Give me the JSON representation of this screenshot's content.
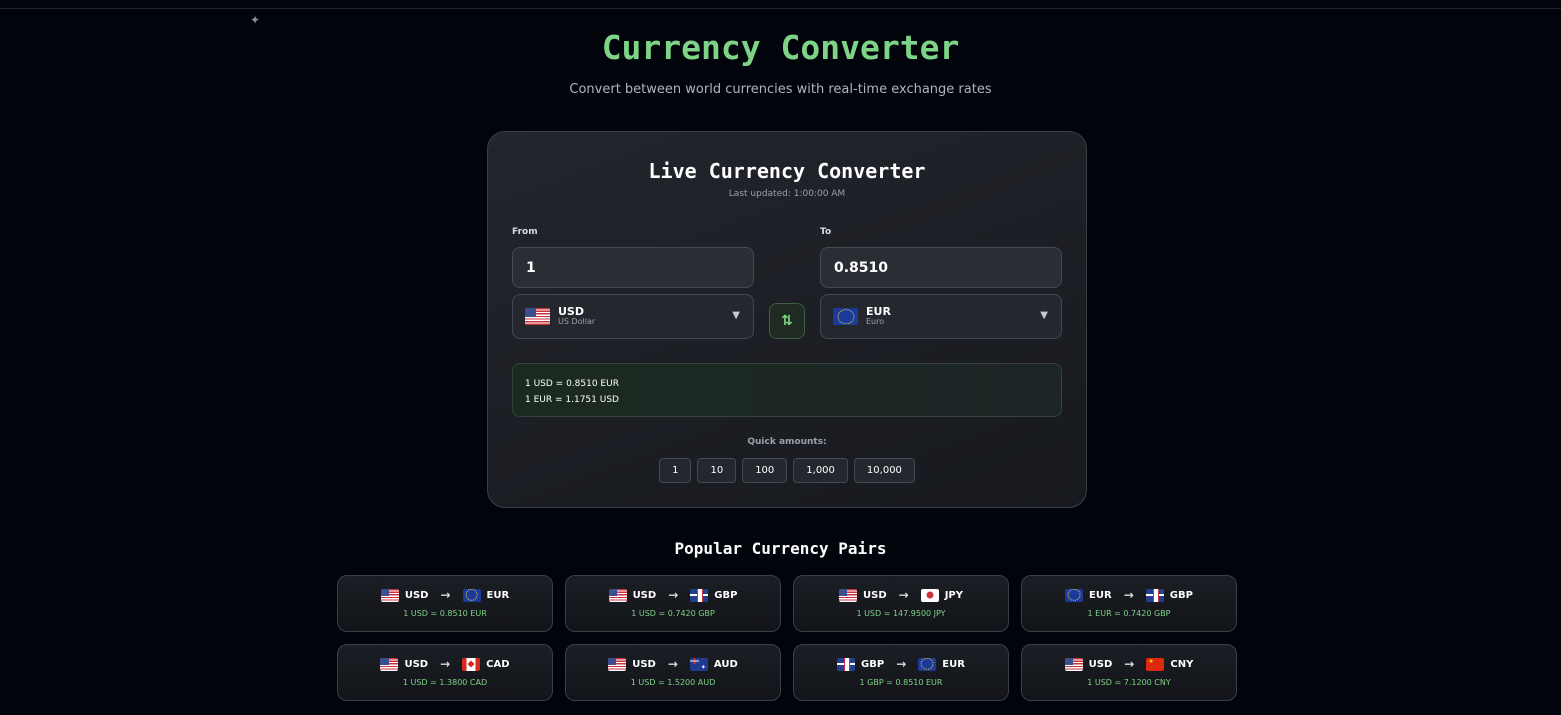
{
  "header": {
    "sparkle": "✦",
    "title": "Currency Converter",
    "subtitle": "Convert between world currencies with real-time exchange rates"
  },
  "converter": {
    "title": "Live Currency Converter",
    "last_updated": "Last updated: 1:00:00 AM",
    "from": {
      "label": "From",
      "amount": "1",
      "currency_code": "USD",
      "currency_name": "US Dollar",
      "flag": "us-flag-icon"
    },
    "to": {
      "label": "To",
      "amount": "0.8510",
      "currency_code": "EUR",
      "currency_name": "Euro",
      "flag": "eu-flag-icon"
    },
    "swap_icon": "⇅",
    "caret": "▼",
    "rates": {
      "forward": "1 USD = 0.8510 EUR",
      "reverse": "1 EUR = 1.1751 USD"
    },
    "quick_label": "Quick amounts:",
    "quick_amounts": [
      "1",
      "10",
      "100",
      "1,000",
      "10,000"
    ]
  },
  "popular": {
    "title": "Popular Currency Pairs",
    "arrow": "→",
    "pairs": [
      {
        "from": "USD",
        "to": "EUR",
        "from_flag": "us",
        "to_flag": "eu",
        "rate": "1 USD = 0.8510 EUR"
      },
      {
        "from": "USD",
        "to": "GBP",
        "from_flag": "us",
        "to_flag": "gb",
        "rate": "1 USD = 0.7420 GBP"
      },
      {
        "from": "USD",
        "to": "JPY",
        "from_flag": "us",
        "to_flag": "jp",
        "rate": "1 USD = 147.9500 JPY"
      },
      {
        "from": "EUR",
        "to": "GBP",
        "from_flag": "eu",
        "to_flag": "gb",
        "rate": "1 EUR = 0.7420 GBP"
      },
      {
        "from": "USD",
        "to": "CAD",
        "from_flag": "us",
        "to_flag": "ca",
        "rate": "1 USD = 1.3800 CAD"
      },
      {
        "from": "USD",
        "to": "AUD",
        "from_flag": "us",
        "to_flag": "au",
        "rate": "1 USD = 1.5200 AUD"
      },
      {
        "from": "GBP",
        "to": "EUR",
        "from_flag": "gb",
        "to_flag": "eu",
        "rate": "1 GBP = 0.8510 EUR"
      },
      {
        "from": "USD",
        "to": "CNY",
        "from_flag": "us",
        "to_flag": "cn",
        "rate": "1 USD = 7.1200 CNY"
      }
    ]
  }
}
